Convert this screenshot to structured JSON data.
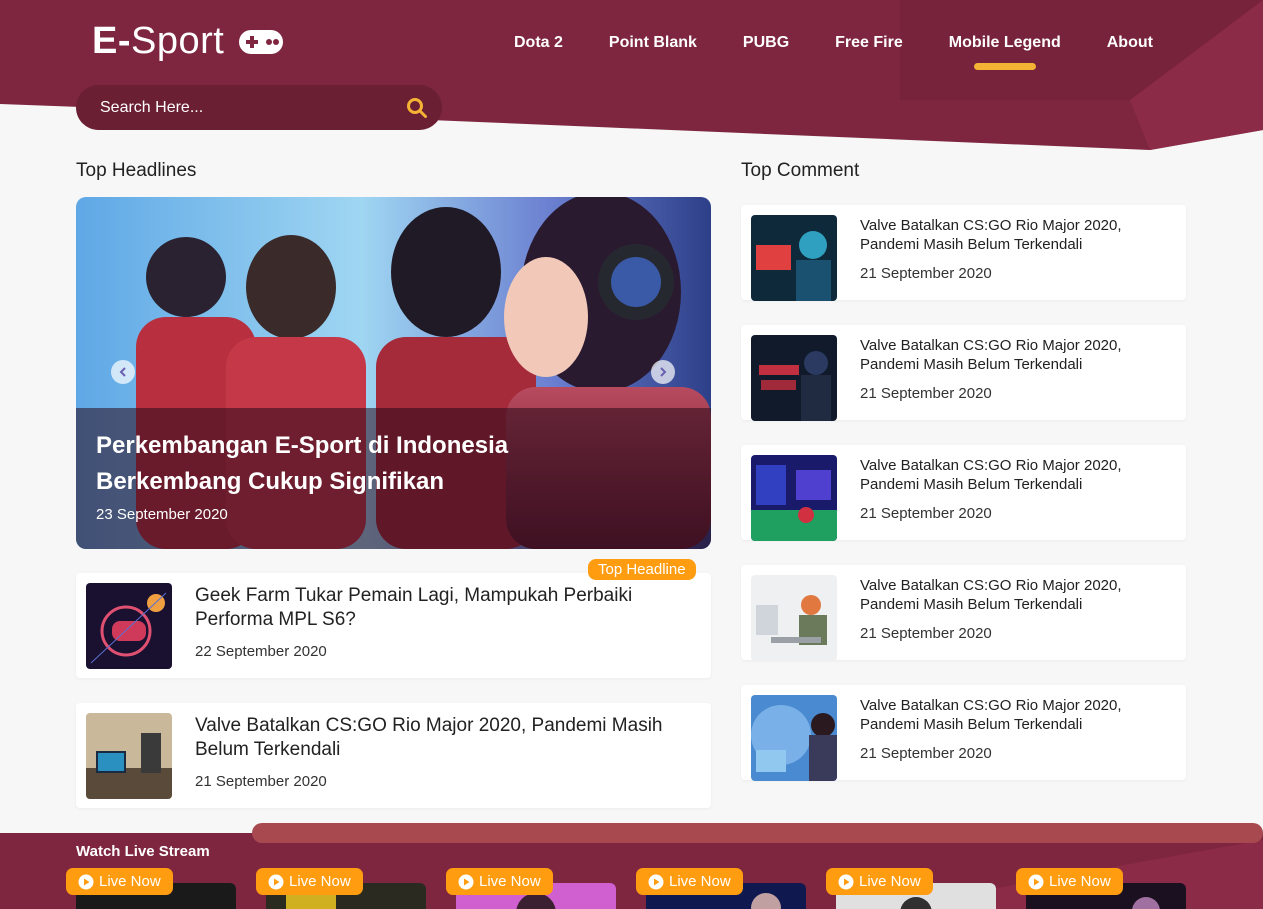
{
  "header": {
    "logo_text_bold": "E-",
    "logo_text": "Sport",
    "logo_icon": "gamepad-icon",
    "nav": [
      {
        "label": "Dota 2",
        "active": false
      },
      {
        "label": "Point Blank",
        "active": false
      },
      {
        "label": "PUBG",
        "active": false
      },
      {
        "label": "Free Fire",
        "active": false
      },
      {
        "label": "Mobile Legend",
        "active": true
      },
      {
        "label": "About",
        "active": false
      }
    ],
    "search_placeholder": "Search Here...",
    "search_icon": "search-icon"
  },
  "headlines": {
    "section_title": "Top Headlines",
    "hero": {
      "title": "Perkembangan E-Sport di Indonesia Berkembang Cukup Signifikan",
      "date": "23 September 2020"
    },
    "badge": "Top Headline",
    "items": [
      {
        "title": "Geek Farm Tukar Pemain Lagi, Mampukah Perbaiki Performa MPL S6?",
        "date": "22 September 2020"
      },
      {
        "title": "Valve Batalkan CS:GO Rio Major 2020, Pandemi Masih Belum Terkendali",
        "date": "21 September 2020"
      }
    ]
  },
  "comments": {
    "section_title": "Top Comment",
    "items": [
      {
        "title": "Valve Batalkan CS:GO Rio Major 2020, Pandemi Masih Belum Terkendali",
        "date": "21 September 2020"
      },
      {
        "title": "Valve Batalkan CS:GO Rio Major 2020, Pandemi Masih Belum Terkendali",
        "date": "21 September 2020"
      },
      {
        "title": "Valve Batalkan CS:GO Rio Major 2020, Pandemi Masih Belum Terkendali",
        "date": "21 September 2020"
      },
      {
        "title": "Valve Batalkan CS:GO Rio Major 2020, Pandemi Masih Belum Terkendali",
        "date": "21 September 2020"
      },
      {
        "title": "Valve Batalkan CS:GO Rio Major 2020, Pandemi Masih Belum Terkendali",
        "date": "21 September 2020"
      }
    ]
  },
  "stream": {
    "section_title": "Watch Live Stream",
    "items": [
      {
        "badge": "Live Now"
      },
      {
        "badge": "Live Now"
      },
      {
        "badge": "Live Now"
      },
      {
        "badge": "Live Now"
      },
      {
        "badge": "Live Now"
      },
      {
        "badge": "Live Now"
      }
    ]
  },
  "colors": {
    "header": "#7e2640",
    "header_accent": "#8c2b47",
    "search_bg": "#6a1f33",
    "nav_indicator": "#f5b335",
    "badge": "#ff9c10",
    "bottom_band": "#7e2640",
    "bottom_bar": "#a84950"
  }
}
